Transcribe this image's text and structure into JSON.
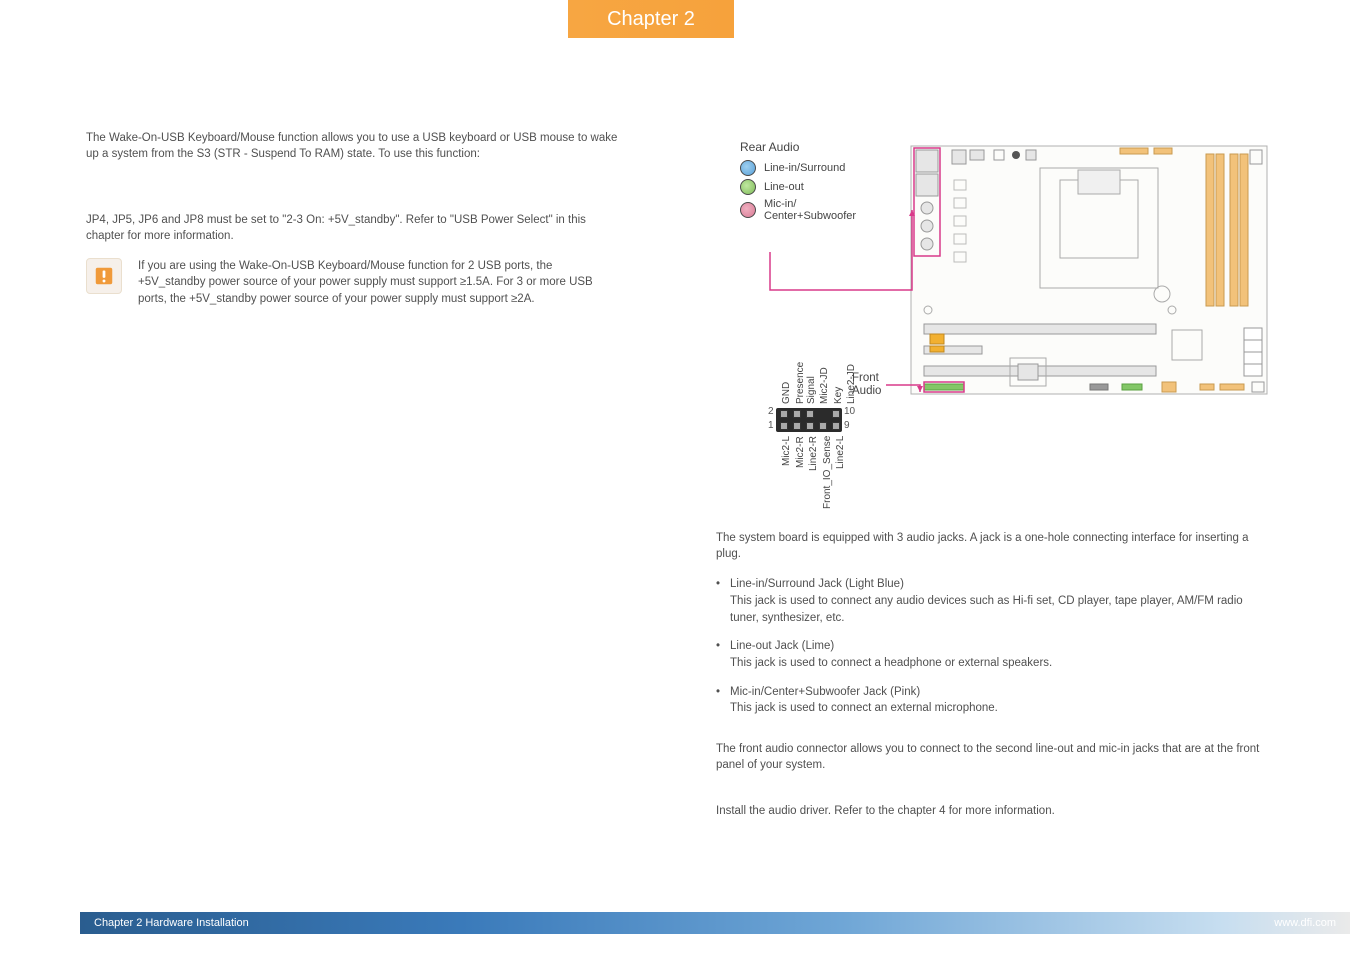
{
  "chapter_tab": "Chapter 2",
  "left": {
    "intro": "The Wake-On-USB Keyboard/Mouse function allows you to use a USB keyboard or USB mouse to wake up a system from the S3 (STR - Suspend To RAM) state. To use this function:",
    "jumper": "JP4, JP5, JP6 and JP8 must be set to \"2-3 On: +5V_standby\". Refer to \"USB Power Select\" in this chapter for more information.",
    "note": "If you are using the Wake-On-USB Keyboard/Mouse function for 2 USB ports, the +5V_standby power source of your power supply must support ≥1.5A. For 3 or more USB ports, the +5V_standby power source of your power supply must support ≥2A."
  },
  "right": {
    "rear_title": "Rear Audio",
    "jacks": [
      {
        "label": "Line-in/Surround",
        "color": "jack-blue"
      },
      {
        "label": "Line-out",
        "color": "jack-lime"
      },
      {
        "label": "Mic-in/\nCenter+Subwoofer",
        "color": "jack-pink"
      }
    ],
    "pin_top": [
      "GND",
      "Presence Signal",
      "Mic2-JD",
      "Key",
      "Line2-JD"
    ],
    "pin_bottom": [
      "Mic2-L",
      "Mic2-R",
      "Line2-R",
      "Front_IO_Sense",
      "Line2-L"
    ],
    "pin_nums": {
      "tl": "2",
      "bl": "1",
      "tr": "10",
      "br": "9"
    },
    "front_audio": "Front\nAudio",
    "body1": "The system board is equipped with 3 audio jacks. A jack is a one-hole connecting interface for inserting a plug.",
    "bullets": [
      {
        "title": "Line-in/Surround Jack (Light Blue)",
        "desc": "This jack is used to connect any audio devices such as Hi-fi set, CD player, tape player, AM/FM radio tuner, synthesizer, etc."
      },
      {
        "title": "Line-out Jack (Lime)",
        "desc": "This jack is used to connect a headphone or external speakers."
      },
      {
        "title": "Mic-in/Center+Subwoofer Jack (Pink)",
        "desc": "This jack is used to connect an external microphone."
      }
    ],
    "body2": "The front audio connector allows you to connect to the second line-out and mic-in jacks that are at the front panel of your system.",
    "body3": "Install the audio driver. Refer to the chapter 4 for more information."
  },
  "footer": {
    "left": "Chapter 2 Hardware Installation",
    "right": "www.dfi.com"
  }
}
